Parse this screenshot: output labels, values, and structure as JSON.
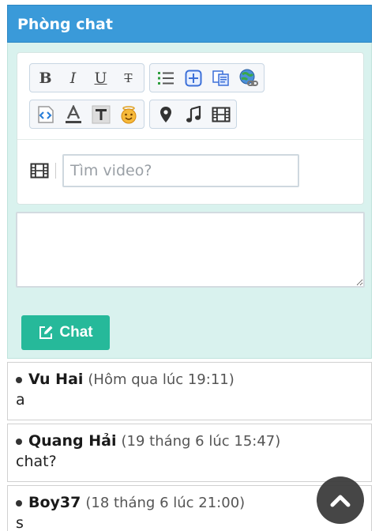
{
  "header": {
    "title": "Phòng chat"
  },
  "toolbar": {
    "row1": [
      {
        "group": "format",
        "items": [
          "bold",
          "italic",
          "underline",
          "strikethrough"
        ]
      },
      {
        "group": "insert",
        "items": [
          "list",
          "insert",
          "copy",
          "link"
        ]
      }
    ],
    "row2": [
      {
        "group": "style",
        "items": [
          "code",
          "font-color",
          "text-size",
          "emoticon"
        ]
      },
      {
        "group": "media",
        "items": [
          "map-pin",
          "music",
          "video"
        ]
      }
    ],
    "bold_glyph": "B",
    "italic_glyph": "I",
    "underline_glyph": "U",
    "strike_glyph": "T"
  },
  "video_search": {
    "placeholder": "Tìm video?"
  },
  "message_input": {
    "value": ""
  },
  "chat_button": {
    "label": "Chat"
  },
  "messages": [
    {
      "user": "Vu Hai",
      "time": "(Hôm qua lúc 19:11)",
      "text": "a"
    },
    {
      "user": "Quang Hải",
      "time": "(19 tháng 6 lúc 15:47)",
      "text": "chat?"
    },
    {
      "user": "Boy37",
      "time": "(18 tháng 6 lúc 21:00)",
      "text": "s"
    }
  ],
  "colors": {
    "header": "#3a9ad9",
    "panel": "#d9f2ee",
    "chat_button": "#26b99a",
    "scroll_button": "#3d3d3d"
  }
}
